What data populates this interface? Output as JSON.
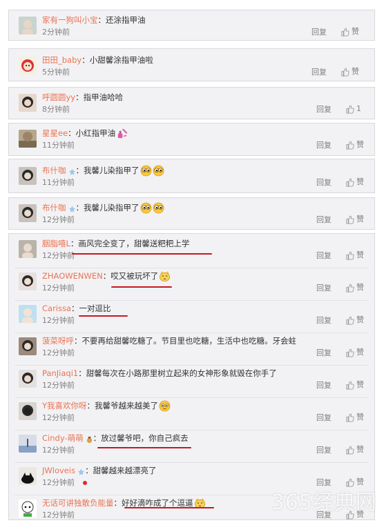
{
  "panels": [
    {
      "comments": [
        {
          "user": "家有一狗叫小宝",
          "text": "还涂指甲油",
          "time": "2分钟前",
          "reply": "回复",
          "like": "赞"
        }
      ]
    },
    {
      "comments": [
        {
          "user": "田田_baby",
          "text": "小甜馨涂指甲油啦",
          "time": "5分钟前",
          "reply": "回复",
          "like": "赞"
        }
      ]
    },
    {
      "comments": [
        {
          "user": "呼圆圆yy",
          "text": "指甲油哈哈",
          "time": "8分钟前",
          "reply": "回复",
          "like": "1"
        }
      ]
    },
    {
      "comments": [
        {
          "user": "星星ee",
          "text": "小红指甲油",
          "time": "11分钟前",
          "reply": "回复",
          "like": "赞"
        }
      ]
    },
    {
      "comments": [
        {
          "user": "布什咖",
          "text": "我馨儿染指甲了",
          "time": "11分钟前",
          "reply": "回复",
          "like": "赞"
        }
      ]
    },
    {
      "comments": [
        {
          "user": "布什咖",
          "text": "我馨儿染指甲了",
          "time": "12分钟前",
          "reply": "回复",
          "like": "赞"
        }
      ]
    },
    {
      "comments": [
        {
          "user": "胭脂嘻L",
          "text": "画风完全变了，甜馨送粑粑上学",
          "time": "12分钟前",
          "reply": "回复",
          "like": "赞"
        },
        {
          "user": "ZHAOWENWEN",
          "text": "哎又被玩坏了",
          "time": "12分钟前",
          "reply": "回复",
          "like": "赞"
        },
        {
          "user": "Carissa",
          "text": "一对逗比",
          "time": "12分钟前",
          "reply": "回复",
          "like": "赞"
        },
        {
          "user": "菠菜呀呼",
          "text": "不要再给甜馨吃糖了。节目里也吃糖，生活中也吃糖。牙会蛀",
          "time": "12分钟前",
          "reply": "回复",
          "like": "赞"
        },
        {
          "user": "PanJiaqi1",
          "text": "甜馨每次在小路那里树立起来的女神形象就毁在你手了",
          "time": "12分钟前",
          "reply": "回复",
          "like": "赞"
        },
        {
          "user": "Y我喜欢你呀",
          "text": "我馨爷越来越美了",
          "time": "12分钟前",
          "reply": "回复",
          "like": "赞"
        },
        {
          "user": "Cindy-萌萌",
          "text": "放过馨爷吧，你自己疯去",
          "time": "12分钟前",
          "reply": "回复",
          "like": "赞"
        },
        {
          "user": "JWloveis",
          "text": "甜馨越来越漂亮了",
          "time": "12分钟前",
          "reply": "回复",
          "like": "赞"
        },
        {
          "user": "无话可讲独散负能量",
          "text": "好好滴咋成了个逗逼",
          "time": "12分钟前",
          "reply": "回复",
          "like": "赞"
        }
      ]
    }
  ],
  "colon": "：",
  "watermark": "365经典网",
  "colors": {
    "username": "#eb7350",
    "text": "#333333",
    "meta": "#808080",
    "underline": "#c9161d",
    "panel_bg": "#f2f2f5"
  }
}
